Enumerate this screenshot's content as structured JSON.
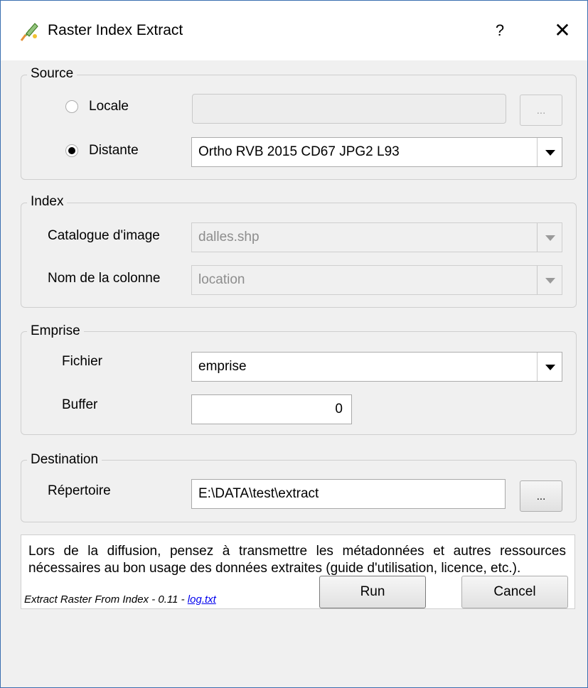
{
  "window": {
    "title": "Raster Index Extract",
    "help_label": "?",
    "close_label": "✕"
  },
  "source": {
    "title": "Source",
    "locale_label": "Locale",
    "locale_value": "",
    "browse_label": "...",
    "distante_label": "Distante",
    "distante_value": "Ortho RVB 2015 CD67 JPG2 L93",
    "selected": "Distante"
  },
  "index": {
    "title": "Index",
    "catalogue_label": "Catalogue d'image",
    "catalogue_value": "dalles.shp",
    "colonne_label": "Nom de la colonne",
    "colonne_value": "location"
  },
  "emprise": {
    "title": "Emprise",
    "fichier_label": "Fichier",
    "fichier_value": "emprise",
    "buffer_label": "Buffer",
    "buffer_value": "0"
  },
  "destination": {
    "title": "Destination",
    "repertoire_label": "Répertoire",
    "repertoire_value": "E:\\DATA\\test\\extract",
    "browse_label": "..."
  },
  "info": {
    "text": "Lors de la diffusion, pensez à transmettre les métadonnées et autres ressources nécessaires au bon usage des données extraites (guide d'utilisation, licence, etc.)."
  },
  "footer": {
    "version_text": "Extract Raster From Index - 0.11 - ",
    "log_link": "log.txt",
    "run_label": "Run",
    "cancel_label": "Cancel"
  },
  "colors": {
    "window_border": "#3a6fb0",
    "dialog_bg": "#f0f0f0",
    "link": "#0000ee"
  }
}
